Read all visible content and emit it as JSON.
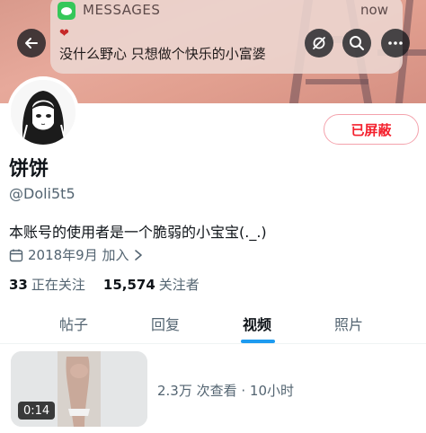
{
  "notification": {
    "app_name": "MESSAGES",
    "time": "now",
    "heart": "❤",
    "message": "没什么野心 只想做个快乐的小富婆"
  },
  "profile": {
    "action_button": "已屏蔽",
    "display_name": "饼饼",
    "handle": "@Doli5t5",
    "bio": "本账号的使用者是一个脆弱的小宝宝(._.)",
    "joined": "2018年9月 加入",
    "following_count": "33",
    "following_label": "正在关注",
    "followers_count": "15,574",
    "followers_label": "关注者"
  },
  "tabs": [
    {
      "label": "帖子",
      "active": false
    },
    {
      "label": "回复",
      "active": false
    },
    {
      "label": "视频",
      "active": true
    },
    {
      "label": "照片",
      "active": false
    }
  ],
  "video": {
    "duration": "0:14",
    "meta": "2.3万 次查看 · 10小时"
  },
  "colors": {
    "accent": "#1d9bf0",
    "blocked_red": "#f4212e",
    "secondary_text": "#536471"
  },
  "icons": [
    "back-arrow-icon",
    "antenna-icon",
    "search-icon",
    "more-icon",
    "calendar-icon",
    "chevron-right-icon",
    "messages-app-icon"
  ]
}
